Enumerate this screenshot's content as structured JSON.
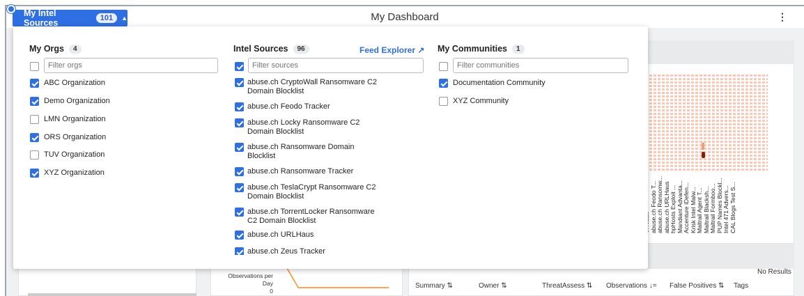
{
  "header": {
    "sources_button_label": "My Intel Sources",
    "sources_count": "101",
    "title": "My Dashboard"
  },
  "dropdown": {
    "orgs": {
      "title": "My Orgs",
      "count": "4",
      "filter_placeholder": "Filter orgs",
      "items": [
        {
          "label": "ABC Organization",
          "checked": true
        },
        {
          "label": "Demo Organization",
          "checked": true
        },
        {
          "label": "LMN Organization",
          "checked": false
        },
        {
          "label": "ORS Organization",
          "checked": true
        },
        {
          "label": "TUV Organization",
          "checked": false
        },
        {
          "label": "XYZ Organization",
          "checked": true
        }
      ]
    },
    "sources": {
      "title": "Intel Sources",
      "count": "96",
      "link": "Feed Explorer ↗",
      "filter_placeholder": "Filter sources",
      "items": [
        {
          "label": "abuse.ch CryptoWall Ransomware C2 Domain Blocklist",
          "checked": true
        },
        {
          "label": "abuse.ch Feodo Tracker",
          "checked": true
        },
        {
          "label": "abuse.ch Locky Ransomware C2 Domain Blocklist",
          "checked": true
        },
        {
          "label": "abuse.ch Ransomware Domain Blocklist",
          "checked": true
        },
        {
          "label": "abuse.ch Ransomware Tracker",
          "checked": true
        },
        {
          "label": "abuse.ch TeslaCrypt Ransomware C2 Domain Blocklist",
          "checked": true
        },
        {
          "label": "abuse.ch TorrentLocker Ransomware C2 Domain Blocklist",
          "checked": true
        },
        {
          "label": "abuse.ch URLHaus",
          "checked": true
        },
        {
          "label": "abuse.ch Zeus Tracker",
          "checked": true
        }
      ]
    },
    "communities": {
      "title": "My Communities",
      "count": "1",
      "filter_placeholder": "Filter communities",
      "items": [
        {
          "label": "Documentation Community",
          "checked": true
        },
        {
          "label": "XYZ Community",
          "checked": false
        }
      ]
    }
  },
  "heatmap": {
    "x_labels": [
      "VXVault",
      "abuse.ch Feodo T...",
      "abuse.ch Ransomw...",
      "abuse.ch URLHaus",
      "hpHosts Exploit ...",
      "Mandiant Advanta...",
      "Accenture iDefen...",
      "Krisk Intel Malw...",
      "Maltrail Agent T...",
      "Maltrail Blacksh...",
      "Maltrail Formboo...",
      "PUP Names Blockl...",
      "Intel 471 Advers...",
      "CAL Blogs Test S..."
    ]
  },
  "observations_panel": {
    "axis_label": "Observations per Day",
    "zero_tick": "0"
  },
  "table_panel": {
    "no_results": "No Results",
    "columns": [
      "Summary ⇅",
      "Owner ⇅",
      "ThreatAssess ⇅",
      "Observations ↓=",
      "False Positives ⇅",
      "Tags"
    ]
  },
  "colors": {
    "accent": "#2f6fe4",
    "heatmap_cell": "#f7c9b6",
    "heatmap_hot": "#8a1c08",
    "line": "#f08a24"
  }
}
